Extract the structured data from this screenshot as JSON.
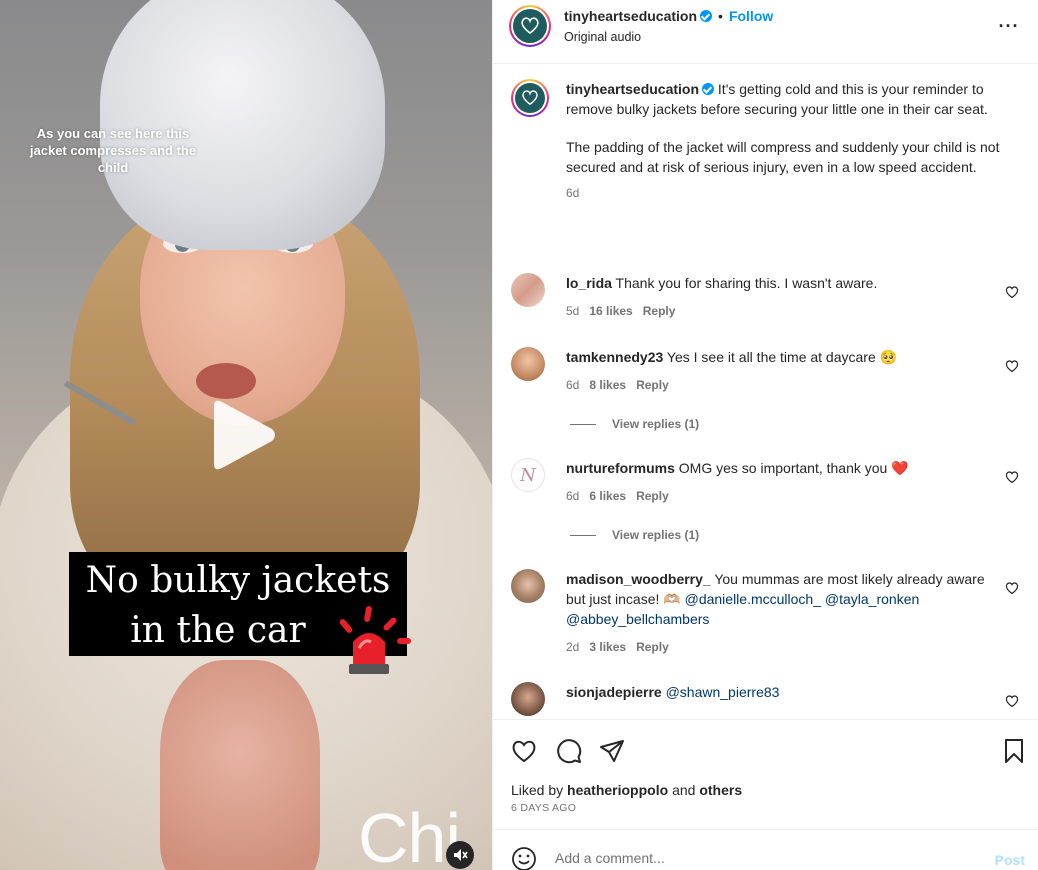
{
  "video": {
    "overlay_caption": "As you can see here this jacket compresses and the child",
    "headline_line1": "No bulky jackets",
    "headline_line2": "in the car",
    "watermark": "Chi"
  },
  "header": {
    "username": "tinyheartseducation",
    "separator": "•",
    "follow_label": "Follow",
    "audio_label": "Original audio",
    "more_label": "···"
  },
  "caption": {
    "username": "tinyheartseducation",
    "text_p1": "It's getting cold and this is your reminder to remove bulky jackets before securing your little one in their car seat.",
    "text_p2": "The padding of the jacket will compress and suddenly your child is not secured and at risk of serious injury, even in a low speed accident.",
    "time": "6d"
  },
  "comments": [
    {
      "username": "lo_rida",
      "text": "Thank you for sharing this. I wasn't aware.",
      "time": "5d",
      "likes": "16 likes",
      "reply": "Reply"
    },
    {
      "username": "tamkennedy23",
      "text": "Yes I see it all the time at daycare 🥺",
      "time": "6d",
      "likes": "8 likes",
      "reply": "Reply",
      "view_replies": "View replies (1)"
    },
    {
      "username": "nurtureformums",
      "text": "OMG yes so important, thank you ❤️",
      "time": "6d",
      "likes": "6 likes",
      "reply": "Reply",
      "view_replies": "View replies (1)"
    },
    {
      "username": "madison_woodberry_",
      "text": "You mummas are most likely already aware but just incase! 🫶🏼",
      "mentions": [
        "@danielle.mcculloch_",
        "@tayla_ronken",
        "@abbey_bellchambers"
      ],
      "time": "2d",
      "likes": "3 likes",
      "reply": "Reply"
    },
    {
      "username": "sionjadepierre",
      "mention": "@shawn_pierre83"
    }
  ],
  "footer": {
    "liked_by_prefix": "Liked by",
    "liked_by_user": "heatherioppolo",
    "liked_by_and": "and",
    "liked_by_others": "others",
    "time_ago": "6 DAYS AGO",
    "comment_placeholder": "Add a comment...",
    "post_label": "Post"
  },
  "colors": {
    "accent": "#0095f6",
    "brand_logo_bg": "#1f5c5e",
    "like_red": "#ed4956"
  }
}
